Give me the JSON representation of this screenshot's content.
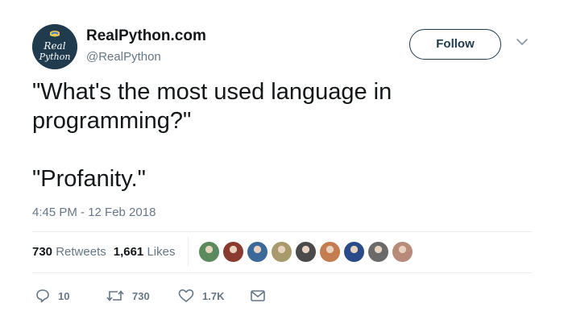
{
  "author": {
    "name": "RealPython.com",
    "handle": "@RealPython",
    "avatar_text_line1": "Real",
    "avatar_text_line2": "Python"
  },
  "follow_button": {
    "label": "Follow"
  },
  "tweet": {
    "text_line1": "\"What's the most used language in programming?\"",
    "text_line2": "\"Profanity.\"",
    "timestamp": "4:45 PM - 12 Feb 2018"
  },
  "stats": {
    "retweets_count": "730",
    "retweets_label": "Retweets",
    "likes_count": "1,661",
    "likes_label": "Likes"
  },
  "likers": [
    {
      "color": "#5a8a5e"
    },
    {
      "color": "#8a3a2e"
    },
    {
      "color": "#3b6a9a"
    },
    {
      "color": "#a89a6a"
    },
    {
      "color": "#4a4a4a"
    },
    {
      "color": "#c57c4e"
    },
    {
      "color": "#2a4a8a"
    },
    {
      "color": "#6a6a6a"
    },
    {
      "color": "#b88a7a"
    }
  ],
  "actions": {
    "reply_count": "10",
    "retweet_count": "730",
    "like_count": "1.7K"
  },
  "icons": {
    "reply": "reply-icon",
    "retweet": "retweet-icon",
    "like": "heart-icon",
    "dm": "envelope-icon",
    "menu": "chevron-down-icon"
  }
}
